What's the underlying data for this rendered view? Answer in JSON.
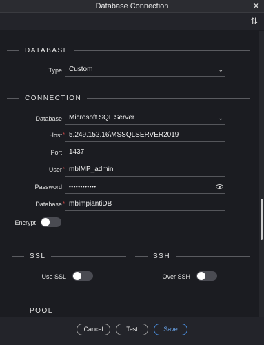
{
  "window": {
    "title": "Database Connection"
  },
  "sections": {
    "database": "DATABASE",
    "connection": "CONNECTION",
    "ssl": "SSL",
    "ssh": "SSH",
    "pool": "POOL"
  },
  "database_section": {
    "type_label": "Type",
    "type_value": "Custom"
  },
  "connection": {
    "database_type_label": "Database",
    "database_type_value": "Microsoft SQL Server",
    "host_label": "Host",
    "host_value": "5.249.152.16\\MSSQLSERVER2019",
    "port_label": "Port",
    "port_value": "1437",
    "user_label": "User",
    "user_value": "mbIMP_admin",
    "password_label": "Password",
    "password_value": "••••••••••••",
    "database_name_label": "Database",
    "database_name_value": "mbimpiantiDB",
    "encrypt_label": "Encrypt",
    "encrypt_on": false
  },
  "ssl": {
    "use_ssl_label": "Use SSL",
    "use_ssl_on": false
  },
  "ssh": {
    "over_ssh_label": "Over SSH",
    "over_ssh_on": false
  },
  "footer": {
    "cancel_label": "Cancel",
    "test_label": "Test",
    "save_label": "Save"
  },
  "colors": {
    "background": "#1b1c21",
    "required_marker": "#c74444",
    "save_accent": "#6aa4ea"
  }
}
